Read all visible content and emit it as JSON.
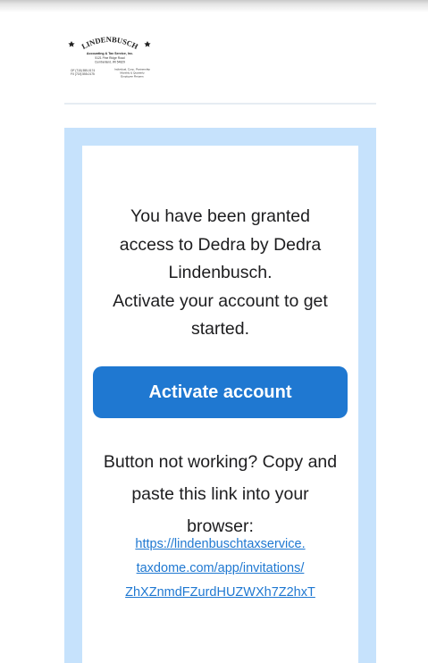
{
  "logo": {
    "brand_name": "LINDENBUSCH",
    "company_name": "Accounting & Tax Service, Inc.",
    "address_line1": "5121 Pine Ridge Road",
    "address_line2": "Cumberland, WI 54829",
    "phone_line1": "OF (715) 555-0174",
    "phone_line2": "FX (715) 555-0175",
    "services_line1": "Individual, Corp., Partnership",
    "services_line2": "Monthly & Quarterly",
    "services_line3": "Employee Returns"
  },
  "message": {
    "line1": "You have been granted",
    "line2": "access to Dedra by Dedra",
    "line3": "Lindenbusch.",
    "line4": "Activate your account to get",
    "line5": "started."
  },
  "activate_button": {
    "label": "Activate account"
  },
  "fallback": {
    "line1": "Button not working? Copy and",
    "line2": "paste this link into your",
    "line3": "browser:"
  },
  "invitation_link": {
    "line1": "https://lindenbuschtaxservice.",
    "line2": "taxdome.com/app/invitations/",
    "line3": "ZhXZnmdFZurdHUZWXh7Z2hxT"
  },
  "colors": {
    "accent_blue": "#1f78d1",
    "frame_blue": "#c6e2fc"
  }
}
